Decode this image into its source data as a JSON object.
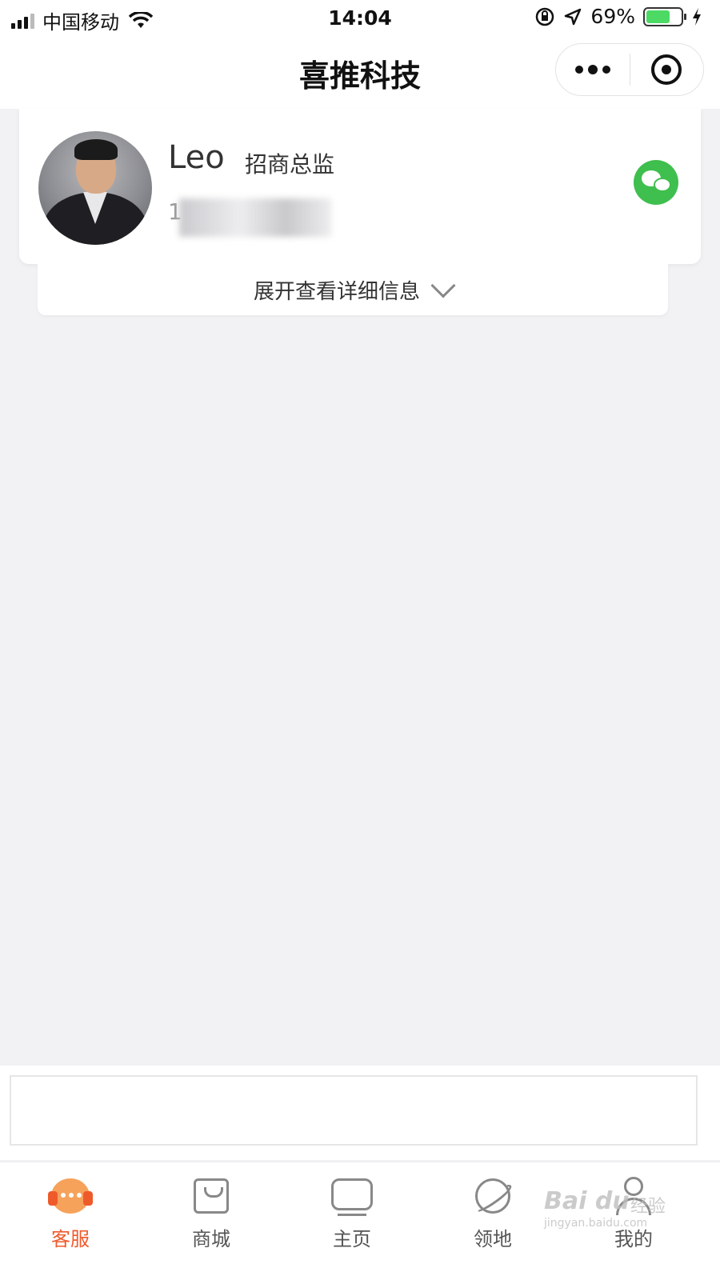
{
  "status_bar": {
    "carrier": "中国移动",
    "time": "14:04",
    "battery_percent": "69%",
    "battery_level": 0.69,
    "battery_color": "#4cd964"
  },
  "nav": {
    "title": "喜推科技"
  },
  "profile": {
    "name": "Leo",
    "job_title": "招商总监",
    "phone_visible": "1"
  },
  "expand": {
    "label": "展开查看详细信息"
  },
  "tabs": [
    {
      "label": "客服",
      "icon": "customer-service-icon",
      "active": true
    },
    {
      "label": "商城",
      "icon": "shopping-bag-icon",
      "active": false
    },
    {
      "label": "主页",
      "icon": "tv-icon",
      "active": false
    },
    {
      "label": "领地",
      "icon": "planet-icon",
      "active": false
    },
    {
      "label": "我的",
      "icon": "user-icon",
      "active": false
    }
  ],
  "watermark": {
    "brand": "Bai du",
    "extra": "经验",
    "sub": "jingyan.baidu.com"
  },
  "colors": {
    "accent": "#ef5a2b",
    "wechat_green": "#3fbf4e",
    "background": "#f2f1f4"
  }
}
